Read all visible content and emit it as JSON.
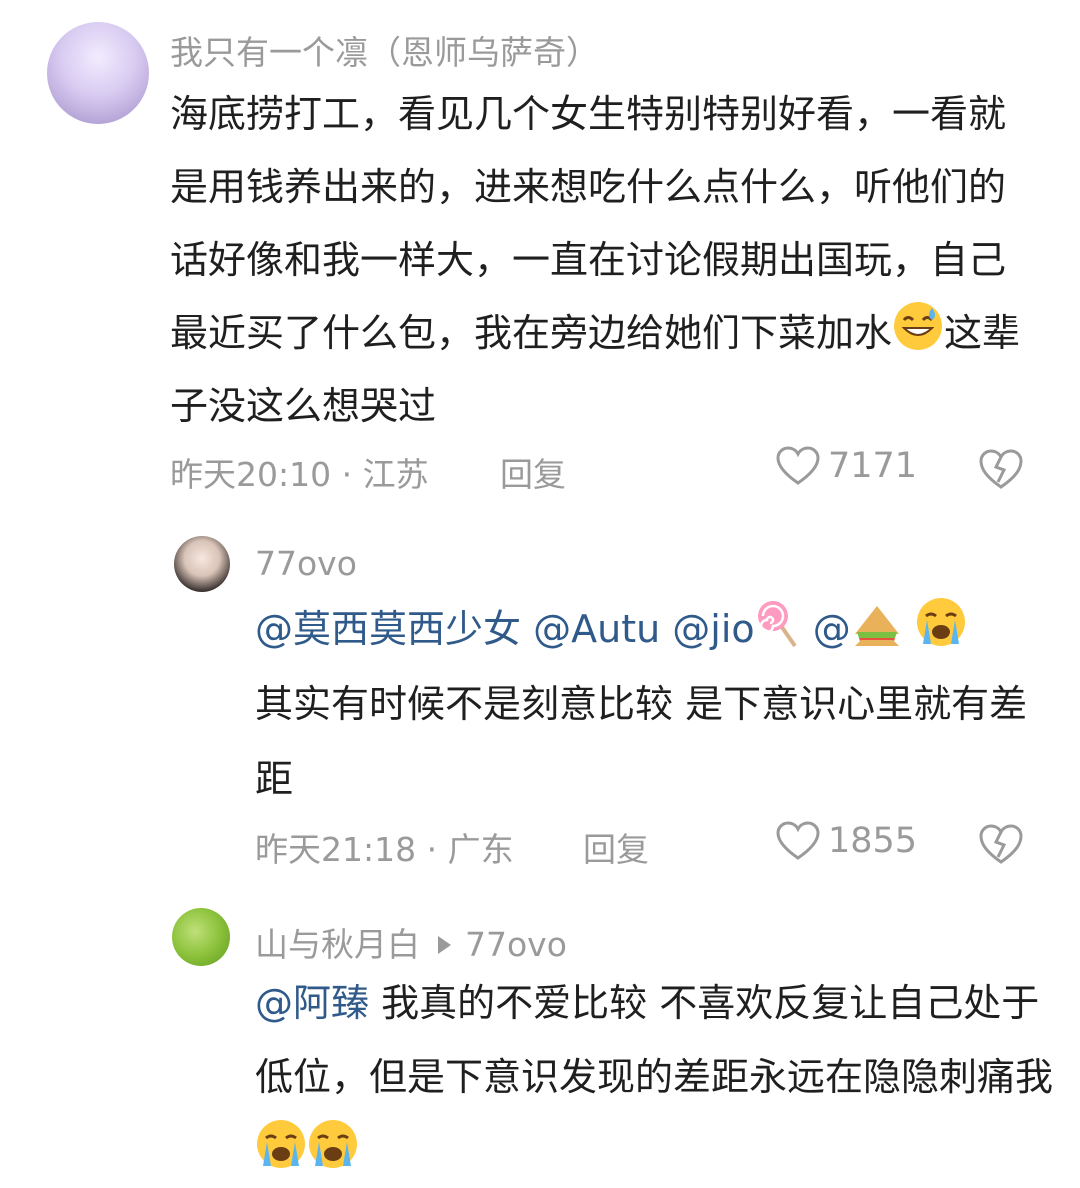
{
  "comments": [
    {
      "username": "我只有一个凛（恩师乌萨奇）",
      "text_before_emoji": "海底捞打工，看见几个女生特别特别好看，一看就是用钱养出来的，进来想吃什么点什么，听他们的话好像和我一样大，一直在讨论假期出国玩，自己最近买了什么包，我在旁边给她们下菜加水",
      "emoji": "grinning-sweat-emoji",
      "text_after_emoji": "这辈子没这么想哭过",
      "time_location": "昨天20:10 · 江苏",
      "reply_label": "回复",
      "likes": "7171"
    },
    {
      "username": "77ovo",
      "mentions": [
        "@莫西莫西少女",
        "@Autu",
        "@jio",
        "@"
      ],
      "mention_emojis": [
        "lollipop-emoji",
        "sandwich-emoji",
        "crying-face-emoji"
      ],
      "text": "其实有时候不是刻意比较 是下意识心里就有差距",
      "time_location": "昨天21:18 · 广东",
      "reply_label": "回复",
      "likes": "1855"
    },
    {
      "username": "山与秋月白",
      "reply_to": "77ovo",
      "mention": "@阿臻",
      "text": "我真的不爱比较 不喜欢反复让自己处于低位，但是下意识发现的差距永远在隐隐刺痛我",
      "emojis": [
        "crying-face-emoji",
        "crying-face-emoji"
      ]
    }
  ],
  "colors": {
    "text": "#1f1f1f",
    "meta": "#9a9a9a",
    "mention": "#2f5a8a"
  }
}
